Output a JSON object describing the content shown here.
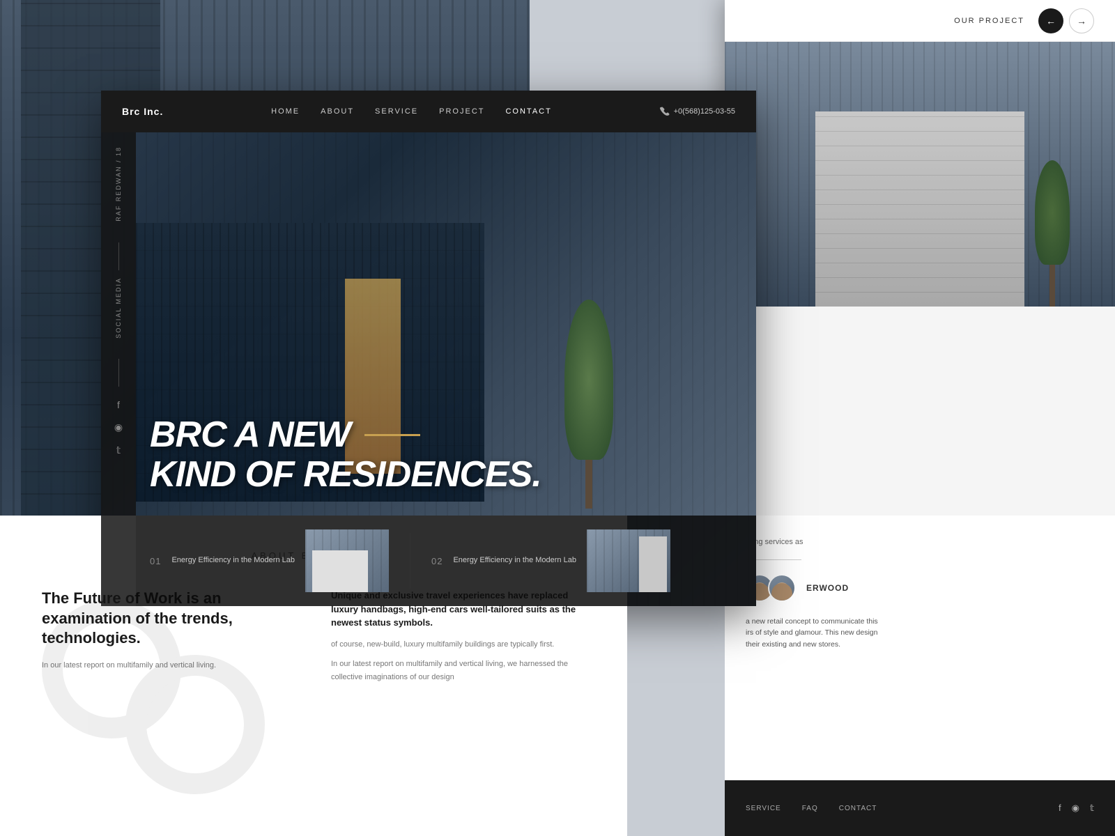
{
  "background": {
    "color": "#c8cdd4"
  },
  "main_website": {
    "navbar": {
      "logo": "Brc Inc.",
      "nav_items": [
        "HOME",
        "ABOUT",
        "SERVICE",
        "PROJECT",
        "CONTACT"
      ],
      "phone": "+0(568)125-03-55"
    },
    "sidebar": {
      "photographer": "Raf Redwan / 18",
      "social_label": "Social media"
    },
    "hero": {
      "title_line1": "BRC A NEW",
      "title_line2": "KIND OF RESIDENCES.",
      "project1_number": "01",
      "project1_title": "Energy Efficiency in the\nModern Lab",
      "project2_number": "02",
      "project2_title": "Energy Efficiency in the\nModern Lab"
    }
  },
  "about_section": {
    "title": "ABOUT  BRC ARCH.",
    "left_heading": "The Future of Work is an examination of the trends, technologies.",
    "left_body": "In our latest report on multifamily and vertical living.",
    "right_heading": "Unique and exclusive travel experiences have replaced luxury handbags, high-end cars well-tailored suits as the newest status symbols.",
    "right_body1": "of course, new-build, luxury multifamily buildings are typically first.",
    "right_body2": "In our latest report on multifamily and vertical living, we harnessed the collective imaginations of our design"
  },
  "right_panel": {
    "nav_label": "OUR PROJECT",
    "arrow_prev": "←",
    "arrow_next": "→",
    "content_text": "ering services as",
    "profile_name": "ERWOOD",
    "long_text1": "a new retail concept to communicate this",
    "long_text2": "irs of style and glamour. This new design",
    "long_text3": "their existing and new stores.",
    "footer_items": [
      "SERVICE",
      "FAQ",
      "CONTACT"
    ],
    "social_icons": [
      "f",
      "ᵢ",
      "𝕥"
    ]
  },
  "social_icons": {
    "facebook": "f",
    "instagram": "⬤",
    "twitter": "🐦"
  },
  "colors": {
    "dark": "#1a1a1a",
    "accent": "#c8a050",
    "light_bg": "#f5f5f5",
    "white": "#ffffff",
    "text_gray": "#888888"
  }
}
